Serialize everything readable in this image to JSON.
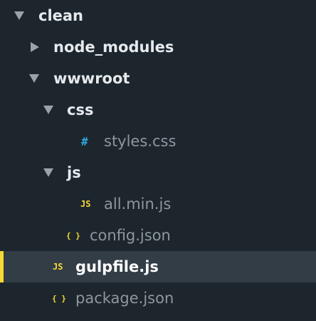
{
  "tree": {
    "root": {
      "label": "clean"
    },
    "node_modules": {
      "label": "node_modules"
    },
    "wwwroot": {
      "label": "wwwroot"
    },
    "css": {
      "label": "css"
    },
    "styles_css": {
      "label": "styles.css",
      "icon": "#"
    },
    "js": {
      "label": "js"
    },
    "all_min_js": {
      "label": "all.min.js",
      "icon": "JS"
    },
    "config_json": {
      "label": "config.json",
      "icon": "{ }"
    },
    "gulpfile_js": {
      "label": "gulpfile.js",
      "icon": "JS"
    },
    "package_json": {
      "label": "package.json",
      "icon": "{ }"
    }
  },
  "icons": {
    "expanded": "triangle-down-icon",
    "collapsed": "triangle-right-icon",
    "css_file": "hash-icon",
    "js_file": "js-icon",
    "json_file": "braces-icon"
  },
  "colors": {
    "background": "#1d262d",
    "selection": "#323d46",
    "selection_accent": "#f6da33",
    "css_icon": "#2eaadc",
    "js_icon": "#f6da33",
    "json_icon": "#f6da33"
  }
}
